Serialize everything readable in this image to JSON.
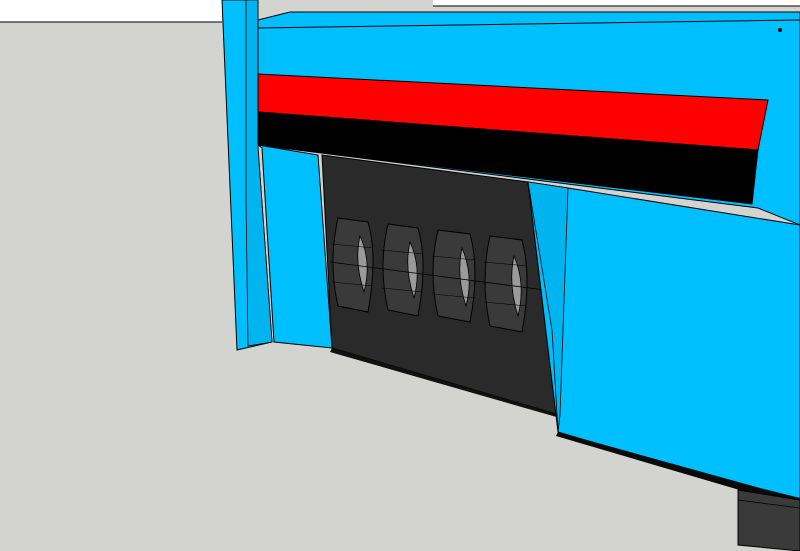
{
  "scene": {
    "background_color": "#d3d3cf",
    "wall_color": "#ffffff",
    "body_color": "#00bfff",
    "stripe_red_color": "#ff0000",
    "stripe_black_color": "#000000",
    "cavity_color": "#2a2a2a",
    "wheel_color": "#3a3a3a",
    "hub_color": "#9a9a9a",
    "edge_color": "#000000",
    "wheel_count": 4
  }
}
